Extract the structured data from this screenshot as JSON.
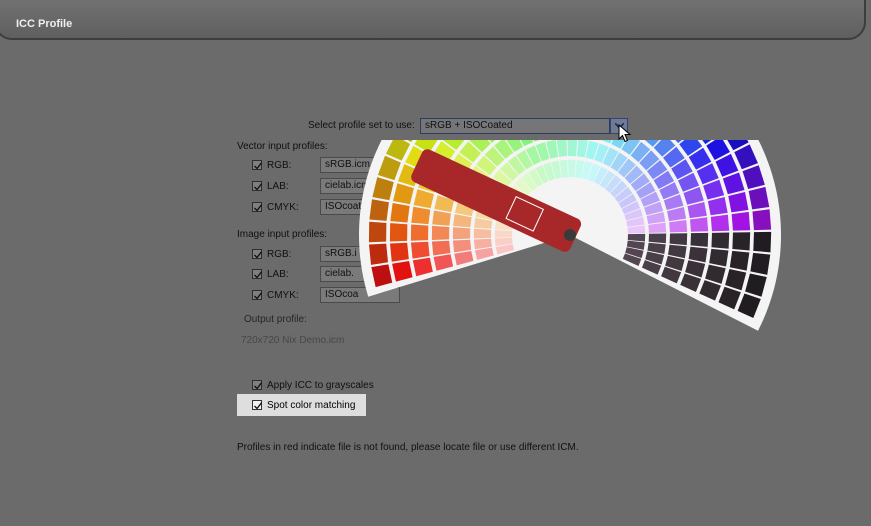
{
  "window": {
    "title": "ICC Profile"
  },
  "profile_set": {
    "label": "Select profile set to use:",
    "value": "sRGB + ISOCoated"
  },
  "vector_input": {
    "heading": "Vector input profiles:",
    "rows": [
      {
        "label": "RGB:",
        "value": "sRGB.icm",
        "checked": true
      },
      {
        "label": "LAB:",
        "value": "cielab.icm",
        "checked": true
      },
      {
        "label": "CMYK:",
        "value": "ISOcoated",
        "checked": true
      }
    ]
  },
  "image_input": {
    "heading": "Image input profiles:",
    "rows": [
      {
        "label": "RGB:",
        "value": "sRGB.i",
        "checked": true
      },
      {
        "label": "LAB:",
        "value": "cielab.",
        "checked": true
      },
      {
        "label": "CMYK:",
        "value": "ISOcoa",
        "checked": true
      }
    ]
  },
  "output": {
    "heading": "Output profile:",
    "value": "720x720 Nix Demo.icm"
  },
  "options": {
    "apply_grayscale": {
      "label": "Apply ICC to grayscales",
      "checked": true
    },
    "spot_color": {
      "label": "Spot color matching",
      "checked": true
    }
  },
  "footer_note": "Profiles in red indicate file is not found, please locate file or use different ICM.",
  "icons": [
    "dropdown-arrow-icon",
    "browse-dots-icon",
    "checkmark-icon",
    "mouse-cursor-icon",
    "color-swatch-fan-image"
  ],
  "colors": {
    "background": "#6b6b6b",
    "swatch_cover": "#a8282a"
  }
}
